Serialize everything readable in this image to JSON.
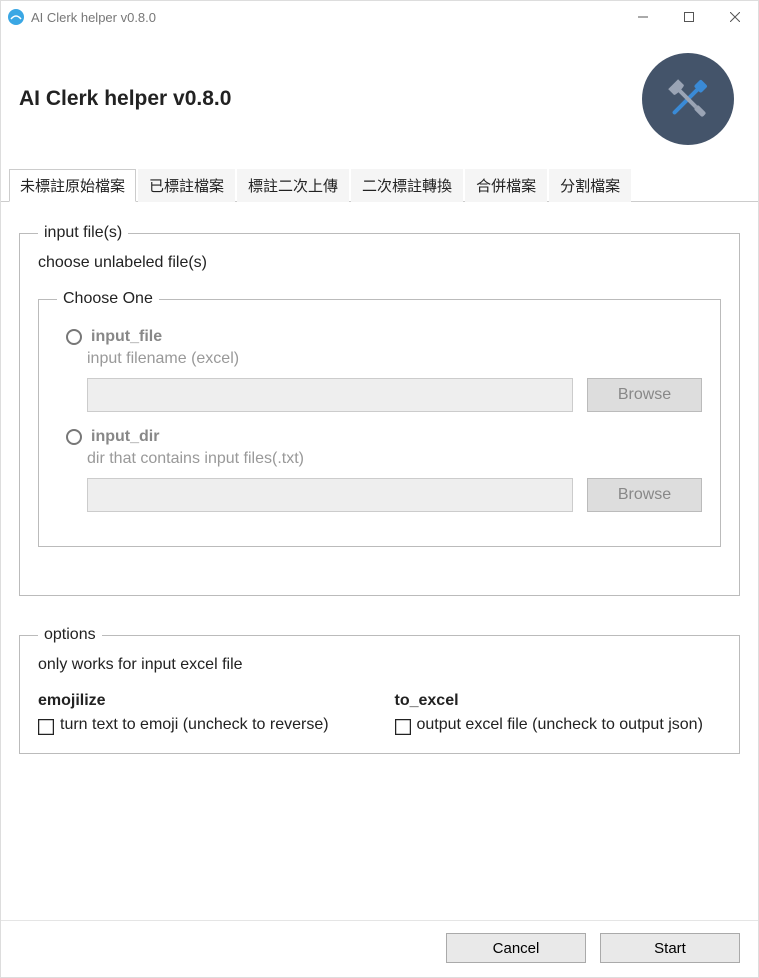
{
  "window": {
    "title": "AI Clerk helper v0.8.0"
  },
  "header": {
    "title": "AI Clerk helper v0.8.0"
  },
  "tabs": [
    {
      "label": "未標註原始檔案",
      "active": true
    },
    {
      "label": "已標註檔案",
      "active": false
    },
    {
      "label": "標註二次上傳",
      "active": false
    },
    {
      "label": "二次標註轉換",
      "active": false
    },
    {
      "label": "合併檔案",
      "active": false
    },
    {
      "label": "分割檔案",
      "active": false
    }
  ],
  "input_section": {
    "legend": "input file(s)",
    "subtitle": "choose unlabeled file(s)",
    "choose_one": {
      "legend": "Choose One",
      "options": [
        {
          "key": "input_file",
          "label": "input_file",
          "hint": "input filename (excel)",
          "value": "",
          "browse": "Browse"
        },
        {
          "key": "input_dir",
          "label": "input_dir",
          "hint": "dir that contains input files(.txt)",
          "value": "",
          "browse": "Browse"
        }
      ]
    }
  },
  "options_section": {
    "legend": "options",
    "subtitle": "only works for input excel file",
    "emojilize": {
      "heading": "emojilize",
      "label": "turn text to emoji (uncheck to reverse)"
    },
    "to_excel": {
      "heading": "to_excel",
      "label": "output excel file (uncheck to output json)"
    }
  },
  "buttons": {
    "cancel": "Cancel",
    "start": "Start"
  }
}
